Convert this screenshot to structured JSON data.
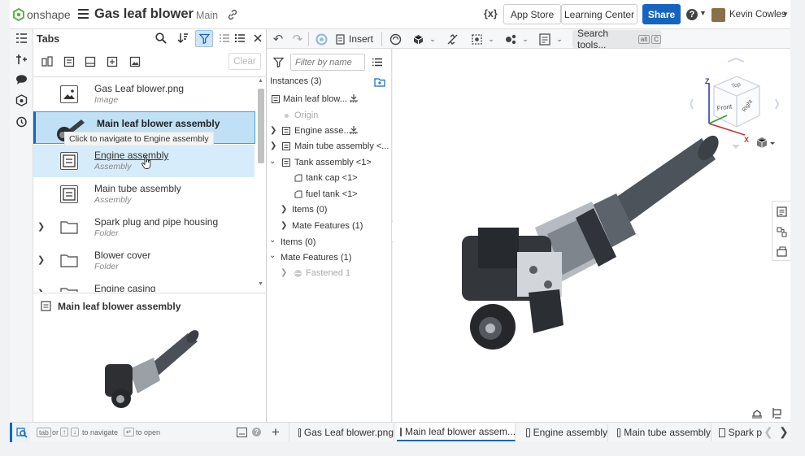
{
  "topbar": {
    "brand": "onshape",
    "doc_title": "Gas leaf blower",
    "branch": "Main",
    "variables_icon": "{x}",
    "app_store": "App Store",
    "learning_center": "Learning Center",
    "share": "Share",
    "help": "?",
    "user": "Kevin Cowles"
  },
  "tabs_panel": {
    "title": "Tabs",
    "clear": "Clear",
    "items": [
      {
        "name": "Gas Leaf blower.png",
        "type": "Image",
        "icon": "image-icon"
      },
      {
        "name": "Main leaf blower assembly",
        "type": "",
        "icon": "assembly-icon"
      },
      {
        "name": "Engine assembly",
        "type": "Assembly",
        "icon": "assembly-icon"
      },
      {
        "name": "Main tube assembly",
        "type": "Assembly",
        "icon": "assembly-icon"
      },
      {
        "name": "Spark plug and pipe housing",
        "type": "Folder",
        "icon": "folder-icon"
      },
      {
        "name": "Blower cover",
        "type": "Folder",
        "icon": "folder-icon"
      },
      {
        "name": "Engine casing",
        "type": "",
        "icon": "folder-icon"
      }
    ],
    "tooltip": "Click to navigate to Engine assembly",
    "preview_title": "Main leaf blower assembly"
  },
  "instances": {
    "filter_placeholder": "Filter by name",
    "header": "Instances (3)",
    "tree": [
      "Main leaf blow...",
      "Origin",
      "Engine asse...",
      "Main tube assembly <...",
      "Tank assembly <1>",
      "tank cap <1>",
      "fuel tank <1>",
      "Items (0)",
      "Mate Features (1)",
      "Items (0)",
      "Mate Features (1)",
      "Fastened 1"
    ]
  },
  "toolbar": {
    "insert": "Insert",
    "search_tools": "Search tools...",
    "shortcut_alt": "alt",
    "shortcut_c": "C"
  },
  "viewcube": {
    "top": "Top",
    "front": "Front",
    "right": "Right",
    "z": "Z",
    "x": "X"
  },
  "bottom_hint": {
    "tab": "tab",
    "or": "or",
    "to_navigate": "to navigate",
    "to_open": "to open"
  },
  "bottom_tabs": [
    "Gas Leaf blower.png",
    "Main leaf blower assem...",
    "Engine assembly",
    "Main tube assembly",
    "Spark p"
  ],
  "colors": {
    "accent": "#1565c0",
    "selected_row": "#bfe0f5",
    "hover_row": "#d7ecfa",
    "logo_green": "#5ab34a"
  }
}
